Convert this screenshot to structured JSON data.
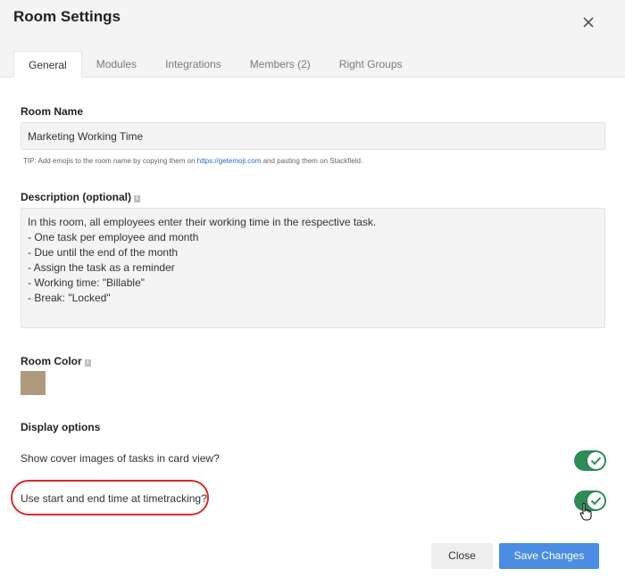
{
  "dialog": {
    "title": "Room Settings",
    "close_icon": "close-icon"
  },
  "tabs": [
    {
      "label": "General",
      "active": true
    },
    {
      "label": "Modules",
      "active": false
    },
    {
      "label": "Integrations",
      "active": false
    },
    {
      "label": "Members (2)",
      "active": false
    },
    {
      "label": "Right Groups",
      "active": false
    }
  ],
  "room_name": {
    "label": "Room Name",
    "value": "Marketing Working Time",
    "tip_prefix": "TIP: Add emojis to the room name by copying them on ",
    "tip_link": "https://getemoji.com",
    "tip_suffix": " and pasting them on Stackfield."
  },
  "description": {
    "label": "Description (optional)",
    "info_icon": "info-icon",
    "lines": [
      "In this room, all employees enter their working time in the respective task.",
      "",
      "- One task per employee and month",
      "- Due until the end of the month",
      "- Assign the task as a reminder",
      "- Working time: \"Billable\"",
      "- Break: \"Locked\""
    ]
  },
  "room_color": {
    "label": "Room Color",
    "value": "#b09a7e"
  },
  "display_options": {
    "label": "Display options",
    "options": [
      {
        "text": "Show cover images of tasks in card view?",
        "enabled": true
      },
      {
        "text": "Use start and end time at timetracking?",
        "enabled": true
      }
    ]
  },
  "footer": {
    "close_label": "Close",
    "save_label": "Save Changes"
  },
  "colors": {
    "toggle_on": "#2e8b57",
    "save_button": "#4a8de2",
    "highlight": "#d62c2c"
  }
}
